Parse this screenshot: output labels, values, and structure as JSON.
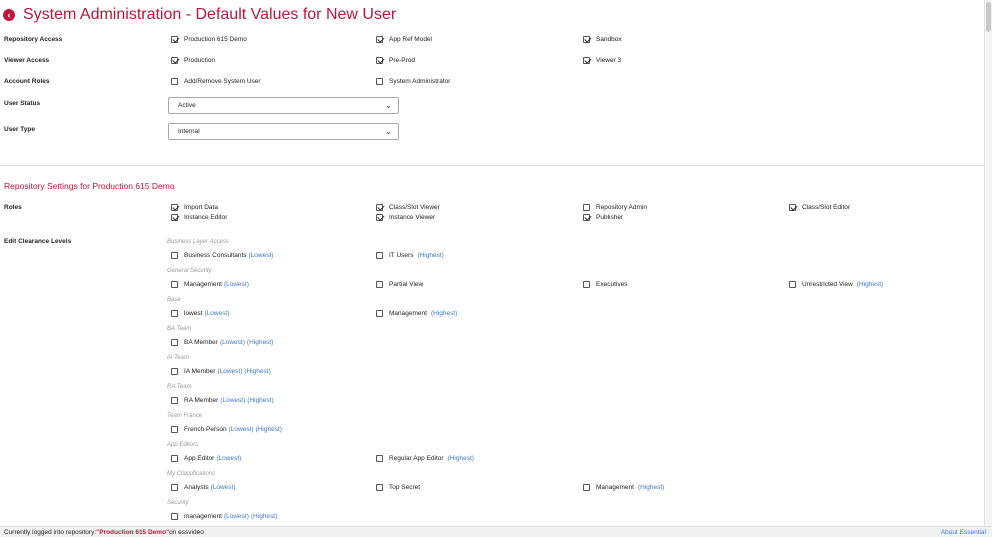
{
  "header": {
    "title": "System Administration - Default Values for New User",
    "back_icon": "chevron-left-icon",
    "accent": "#c0143c"
  },
  "user_defaults": {
    "repository_access": {
      "label": "Repository Access",
      "items": [
        {
          "label": "Production 615 Demo",
          "checked": true
        },
        {
          "label": "App Ref Model",
          "checked": true
        },
        {
          "label": "Sandbox",
          "checked": true
        }
      ]
    },
    "viewer_access": {
      "label": "Viewer Access",
      "items": [
        {
          "label": "Production",
          "checked": true
        },
        {
          "label": "Pre-Prod",
          "checked": true
        },
        {
          "label": "Viewer 3",
          "checked": true
        }
      ]
    },
    "account_roles": {
      "label": "Account Roles",
      "items": [
        {
          "label": "Add/Remove System User",
          "checked": false
        },
        {
          "label": "System Administrator",
          "checked": false
        }
      ]
    },
    "user_status": {
      "label": "User Status",
      "value": "Active"
    },
    "user_type": {
      "label": "User Type",
      "value": "Internal"
    }
  },
  "repo_settings": {
    "title": "Repository Settings for Production 615 Demo",
    "roles": {
      "label": "Roles",
      "items": [
        {
          "label": "Import Data",
          "checked": true
        },
        {
          "label": "Instance Editor",
          "checked": true
        },
        {
          "label": "Class/Slot Viewer",
          "checked": true
        },
        {
          "label": "Instance Viewer",
          "checked": true
        },
        {
          "label": "Repository Admin",
          "checked": false
        },
        {
          "label": "Publisher",
          "checked": true
        },
        {
          "label": "Class/Slot Editor",
          "checked": true
        }
      ]
    },
    "clearance": {
      "label": "Edit Clearance Levels",
      "groups": [
        {
          "name": "Business Layer Access",
          "items": [
            {
              "label": "Business Consultants",
              "lowest": "(Lowest)",
              "highest": ""
            },
            {
              "label": "IT Users",
              "lowest": "",
              "highest": "(Highest)"
            }
          ]
        },
        {
          "name": "General Security",
          "items": [
            {
              "label": "Management",
              "lowest": "(Lowest)",
              "highest": ""
            },
            {
              "label": "Partial View",
              "lowest": "",
              "highest": ""
            },
            {
              "label": "Executives",
              "lowest": "",
              "highest": ""
            },
            {
              "label": "Unrestricted View",
              "lowest": "",
              "highest": "(Highest)"
            }
          ]
        },
        {
          "name": "Base",
          "items": [
            {
              "label": "lowest",
              "lowest": "(Lowest)",
              "highest": ""
            },
            {
              "label": "Management",
              "lowest": "",
              "highest": "(Highest)"
            }
          ]
        },
        {
          "name": "BA Team",
          "items": [
            {
              "label": "BA Member",
              "lowest": "(Lowest)",
              "highest": "(Highest)"
            }
          ]
        },
        {
          "name": "IA Team",
          "items": [
            {
              "label": "IA Member",
              "lowest": "(Lowest)",
              "highest": "(Highest)"
            }
          ]
        },
        {
          "name": "RA Team",
          "items": [
            {
              "label": "RA Member",
              "lowest": "(Lowest)",
              "highest": "(Highest)"
            }
          ]
        },
        {
          "name": "Team France",
          "items": [
            {
              "label": "French Person",
              "lowest": "(Lowest)",
              "highest": "(Highest)"
            }
          ]
        },
        {
          "name": "App Editors",
          "items": [
            {
              "label": "App Editor",
              "lowest": "(Lowest)",
              "highest": ""
            },
            {
              "label": "Regular App Editor",
              "lowest": "",
              "highest": "(Highest)"
            }
          ]
        },
        {
          "name": "My Classifications",
          "items": [
            {
              "label": "Analysts",
              "lowest": "(Lowest)",
              "highest": ""
            },
            {
              "label": "Top Secret",
              "lowest": "",
              "highest": ""
            },
            {
              "label": "Management",
              "lowest": "",
              "highest": "(Highest)"
            }
          ]
        },
        {
          "name": "Security",
          "items": [
            {
              "label": "management",
              "lowest": "(Lowest)",
              "highest": "(Highest)"
            }
          ]
        }
      ]
    }
  },
  "footer": {
    "prefix": "Currently logged into repository: ",
    "repo": "\"Production 615 Demo\"",
    "suffix": " on essvideo",
    "about": "About Essential"
  }
}
